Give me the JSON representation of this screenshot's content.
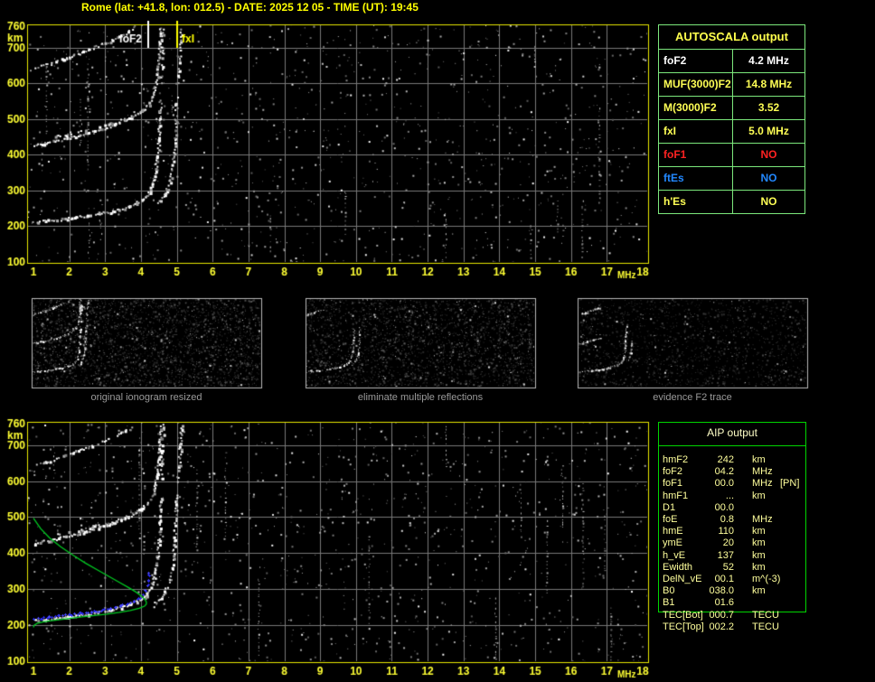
{
  "header": {
    "title": "Rome (lat: +41.8, lon: 012.5) - DATE: 2025 12 05 - TIME (UT): 19:45"
  },
  "autoscala": {
    "title": "AUTOSCALA output",
    "rows": [
      {
        "label": "foF2",
        "value": "4.2 MHz",
        "color": "#FFFFFF"
      },
      {
        "label": "MUF(3000)F2",
        "value": "14.8 MHz",
        "color": "#FFFF55"
      },
      {
        "label": "M(3000)F2",
        "value": "3.52",
        "color": "#FFFF55"
      },
      {
        "label": "fxI",
        "value": "5.0 MHz",
        "color": "#FFFF55"
      },
      {
        "label": "foF1",
        "value": "NO",
        "color": "#FF2222"
      },
      {
        "label": "ftEs",
        "value": "NO",
        "color": "#2288FF"
      },
      {
        "label": "h'Es",
        "value": "NO",
        "color": "#FFFF55"
      }
    ]
  },
  "aip": {
    "title": "AIP output",
    "rows": [
      {
        "label": "hmF2",
        "value": "242",
        "unit": "km",
        "extra": ""
      },
      {
        "label": "foF2",
        "value": "04.2",
        "unit": "MHz",
        "extra": ""
      },
      {
        "label": "foF1",
        "value": "00.0",
        "unit": "MHz",
        "extra": "[PN]"
      },
      {
        "label": "hmF1",
        "value": "...",
        "unit": "km",
        "extra": ""
      },
      {
        "label": "D1",
        "value": "00.0",
        "unit": "",
        "extra": ""
      },
      {
        "label": "foE",
        "value": "0.8",
        "unit": "MHz",
        "extra": ""
      },
      {
        "label": "hmE",
        "value": "110",
        "unit": "km",
        "extra": ""
      },
      {
        "label": "ymE",
        "value": "20",
        "unit": "km",
        "extra": ""
      },
      {
        "label": "h_vE",
        "value": "137",
        "unit": "km",
        "extra": ""
      },
      {
        "label": "Ewidth",
        "value": "52",
        "unit": "km",
        "extra": ""
      },
      {
        "label": "DelN_vE",
        "value": "00.1",
        "unit": "m^(-3)",
        "extra": ""
      },
      {
        "label": "B0",
        "value": "038.0",
        "unit": "km",
        "extra": ""
      },
      {
        "label": "B1",
        "value": "01.6",
        "unit": "",
        "extra": ""
      },
      {
        "label": "TEC[Bot]",
        "value": "000.7",
        "unit": "TECU",
        "extra": ""
      },
      {
        "label": "TEC[Top]",
        "value": "002.2",
        "unit": "TECU",
        "extra": ""
      }
    ]
  },
  "thumbnails": [
    {
      "caption": "original ionogram resized"
    },
    {
      "caption": "eliminate multiple reflections"
    },
    {
      "caption": "evidence F2 trace"
    }
  ],
  "colors": {
    "axis_yellow": "#FFFF33",
    "plot_border": "#E8E800",
    "grid_gray": "#787878",
    "caption_gray": "#9A9A9A",
    "profile_green": "#00CC22",
    "trace_blue": "#2A2AEE",
    "marker_fof2": "#FFFFFF",
    "marker_fxi": "#FFFF00"
  },
  "chart_data": {
    "type": "scatter",
    "title": "ionogram virtual height vs frequency",
    "xlabel": "MHz",
    "ylabel": "km",
    "x_axis": {
      "range": [
        1,
        18
      ],
      "ticks": [
        1,
        2,
        3,
        4,
        5,
        6,
        7,
        8,
        9,
        10,
        11,
        12,
        13,
        14,
        15,
        16,
        17,
        18
      ]
    },
    "y_axis": {
      "range": [
        100,
        760
      ],
      "ticks": [
        760,
        700,
        600,
        500,
        400,
        300,
        200,
        100
      ]
    },
    "grid": true,
    "echo_traces": {
      "f2_ordinary": [
        [
          1.0,
          213
        ],
        [
          1.3,
          216
        ],
        [
          1.6,
          219
        ],
        [
          1.9,
          223
        ],
        [
          2.2,
          227
        ],
        [
          2.5,
          231
        ],
        [
          2.8,
          236
        ],
        [
          3.1,
          242
        ],
        [
          3.4,
          249
        ],
        [
          3.65,
          257
        ],
        [
          3.85,
          265
        ],
        [
          4.0,
          274
        ],
        [
          4.12,
          284
        ],
        [
          4.22,
          297
        ],
        [
          4.3,
          313
        ],
        [
          4.36,
          333
        ],
        [
          4.41,
          360
        ],
        [
          4.45,
          395
        ],
        [
          4.48,
          435
        ],
        [
          4.5,
          480
        ],
        [
          4.52,
          525
        ],
        [
          4.53,
          555
        ]
      ],
      "f2_extraordinary": [
        [
          4.4,
          262
        ],
        [
          4.52,
          274
        ],
        [
          4.63,
          289
        ],
        [
          4.72,
          307
        ],
        [
          4.8,
          330
        ],
        [
          4.86,
          360
        ],
        [
          4.9,
          400
        ],
        [
          4.93,
          445
        ],
        [
          4.95,
          495
        ],
        [
          4.97,
          545
        ],
        [
          4.98,
          565
        ]
      ],
      "second_hop": [
        [
          1.0,
          428
        ],
        [
          1.3,
          434
        ],
        [
          1.6,
          440
        ],
        [
          1.9,
          447
        ],
        [
          2.2,
          454
        ],
        [
          2.5,
          462
        ],
        [
          2.8,
          471
        ],
        [
          3.1,
          481
        ],
        [
          3.4,
          492
        ],
        [
          3.65,
          503
        ],
        [
          3.85,
          514
        ],
        [
          4.05,
          527
        ],
        [
          4.2,
          543
        ],
        [
          4.3,
          562
        ],
        [
          4.38,
          588
        ],
        [
          4.44,
          622
        ],
        [
          4.48,
          664
        ],
        [
          4.51,
          710
        ],
        [
          4.53,
          755
        ]
      ],
      "second_hop_b": [
        [
          1.6,
          452
        ],
        [
          2.0,
          460
        ],
        [
          2.4,
          468
        ],
        [
          2.8,
          478
        ],
        [
          3.2,
          489
        ],
        [
          3.5,
          500
        ],
        [
          3.8,
          512
        ],
        [
          4.0,
          524
        ]
      ],
      "second_hop_x": [
        [
          5.0,
          600
        ],
        [
          5.05,
          648
        ],
        [
          5.08,
          695
        ],
        [
          5.1,
          740
        ],
        [
          5.11,
          758
        ]
      ],
      "third_hop": [
        [
          1.0,
          645
        ],
        [
          1.3,
          654
        ],
        [
          1.6,
          663
        ],
        [
          1.9,
          673
        ],
        [
          2.2,
          684
        ],
        [
          2.5,
          695
        ],
        [
          2.8,
          707
        ],
        [
          3.1,
          719
        ],
        [
          3.35,
          731
        ],
        [
          3.6,
          744
        ],
        [
          3.8,
          756
        ]
      ],
      "asymptote_fragments": [
        [
          4.55,
          600
        ],
        [
          4.57,
          650
        ],
        [
          4.59,
          700
        ],
        [
          4.6,
          745
        ],
        [
          4.61,
          758
        ]
      ]
    },
    "plots": [
      {
        "name": "autoscala-ionogram",
        "markers": [
          {
            "label": "foF2",
            "freq_mhz": 4.2,
            "color": "#FFFFFF"
          },
          {
            "label": "fxI",
            "freq_mhz": 5.0,
            "color": "#FFFF00"
          }
        ]
      },
      {
        "name": "aip-ionogram",
        "profile_green": [
          [
            1.0,
            497
          ],
          [
            1.2,
            468
          ],
          [
            1.45,
            442
          ],
          [
            1.75,
            418
          ],
          [
            2.1,
            394
          ],
          [
            2.45,
            372
          ],
          [
            2.8,
            352
          ],
          [
            3.1,
            335
          ],
          [
            3.4,
            318
          ],
          [
            3.65,
            304
          ],
          [
            3.85,
            292
          ],
          [
            4.0,
            281
          ],
          [
            4.1,
            272
          ],
          [
            4.15,
            264
          ],
          [
            4.15,
            258
          ],
          [
            4.1,
            252
          ],
          [
            3.95,
            246
          ],
          [
            3.7,
            240
          ],
          [
            3.4,
            235
          ],
          [
            3.05,
            230
          ],
          [
            2.7,
            226
          ],
          [
            2.35,
            222
          ],
          [
            2.0,
            218
          ],
          [
            1.7,
            214
          ],
          [
            1.45,
            211
          ],
          [
            1.25,
            208
          ],
          [
            1.1,
            204
          ],
          [
            1.02,
            199
          ],
          [
            1.0,
            193
          ]
        ],
        "scaled_trace_blue": [
          [
            1.0,
            217
          ],
          [
            1.2,
            219
          ],
          [
            1.45,
            222
          ],
          [
            1.7,
            225
          ],
          [
            2.0,
            228
          ],
          [
            2.3,
            232
          ],
          [
            2.6,
            236
          ],
          [
            2.9,
            241
          ],
          [
            3.15,
            246
          ],
          [
            3.4,
            252
          ],
          [
            3.6,
            258
          ],
          [
            3.8,
            266
          ],
          [
            3.95,
            275
          ],
          [
            4.05,
            285
          ],
          [
            4.12,
            297
          ],
          [
            4.17,
            310
          ],
          [
            4.2,
            323
          ],
          [
            4.22,
            337
          ],
          [
            4.23,
            348
          ]
        ]
      }
    ]
  }
}
